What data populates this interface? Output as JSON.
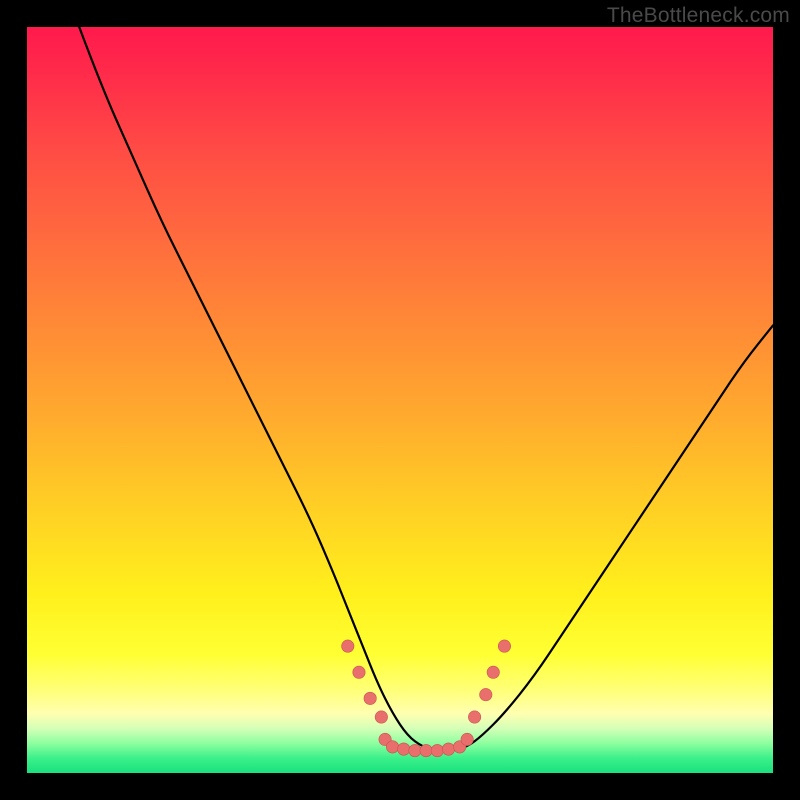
{
  "watermark": "TheBottleneck.com",
  "colors": {
    "frame": "#000000",
    "curve_stroke": "#000000",
    "marker_fill": "#e96f6d",
    "marker_stroke": "#c85250"
  },
  "chart_data": {
    "type": "line",
    "title": "",
    "xlabel": "",
    "ylabel": "",
    "xlim": [
      0,
      100
    ],
    "ylim": [
      0,
      100
    ],
    "note": "Axes unlabeled; values are percentages of plot width/height. y=0 is bottom (green), y=100 is top (red). Curve is a V-shaped bottleneck profile.",
    "series": [
      {
        "name": "bottleneck-curve",
        "x": [
          7,
          10,
          14,
          18,
          22,
          26,
          30,
          34,
          38,
          41,
          43,
          45,
          47,
          49,
          51,
          53,
          55,
          57,
          59,
          61,
          64,
          68,
          72,
          76,
          80,
          84,
          88,
          92,
          96,
          100
        ],
        "y": [
          100,
          92,
          83,
          74,
          66,
          58,
          50,
          42,
          34,
          27,
          22,
          17,
          12,
          8,
          5,
          3.5,
          3,
          3,
          3.5,
          5,
          8,
          13,
          19,
          25,
          31,
          37,
          43,
          49,
          55,
          60
        ]
      }
    ],
    "markers": {
      "name": "highlight-dots",
      "points": [
        {
          "x": 43.0,
          "y": 17.0
        },
        {
          "x": 44.5,
          "y": 13.5
        },
        {
          "x": 46.0,
          "y": 10.0
        },
        {
          "x": 47.5,
          "y": 7.5
        },
        {
          "x": 48.0,
          "y": 4.5
        },
        {
          "x": 49.0,
          "y": 3.5
        },
        {
          "x": 50.5,
          "y": 3.2
        },
        {
          "x": 52.0,
          "y": 3.0
        },
        {
          "x": 53.5,
          "y": 3.0
        },
        {
          "x": 55.0,
          "y": 3.0
        },
        {
          "x": 56.5,
          "y": 3.2
        },
        {
          "x": 58.0,
          "y": 3.5
        },
        {
          "x": 59.0,
          "y": 4.5
        },
        {
          "x": 60.0,
          "y": 7.5
        },
        {
          "x": 61.5,
          "y": 10.5
        },
        {
          "x": 62.5,
          "y": 13.5
        },
        {
          "x": 64.0,
          "y": 17.0
        }
      ]
    }
  }
}
